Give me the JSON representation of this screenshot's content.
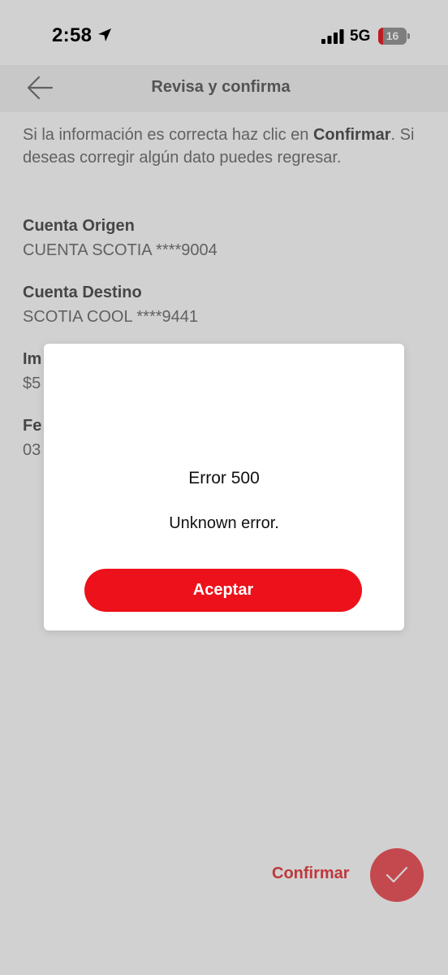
{
  "status_bar": {
    "time": "2:58",
    "network": "5G",
    "battery_level": "16",
    "battery_fraction": 0.16,
    "icons": [
      "location-arrow-icon",
      "signal-bars-icon",
      "battery-icon"
    ]
  },
  "header": {
    "title": "Revisa y confirma",
    "back_icon": "arrow-left-icon"
  },
  "intro": {
    "text_before": "Si la información es correcta haz clic en ",
    "bold": "Confirmar",
    "text_after": ". Si deseas corregir algún dato puedes regresar."
  },
  "fields": {
    "origen": {
      "label": "Cuenta Origen",
      "value": "CUENTA SCOTIA ****9004"
    },
    "destino": {
      "label": "Cuenta Destino",
      "value": "SCOTIA COOL ****9441"
    },
    "importe": {
      "label": "Im",
      "value": "$5"
    },
    "fecha": {
      "label": "Fe",
      "value": "03"
    }
  },
  "actions": {
    "confirm_label": "Confirmar",
    "confirm_icon": "checkmark-icon"
  },
  "dialog": {
    "title": "Error 500",
    "message": "Unknown error.",
    "button_label": "Aceptar"
  },
  "colors": {
    "brand_red": "#ec111a",
    "fab_red": "#ef5a60",
    "battery_red": "#e8232b"
  }
}
